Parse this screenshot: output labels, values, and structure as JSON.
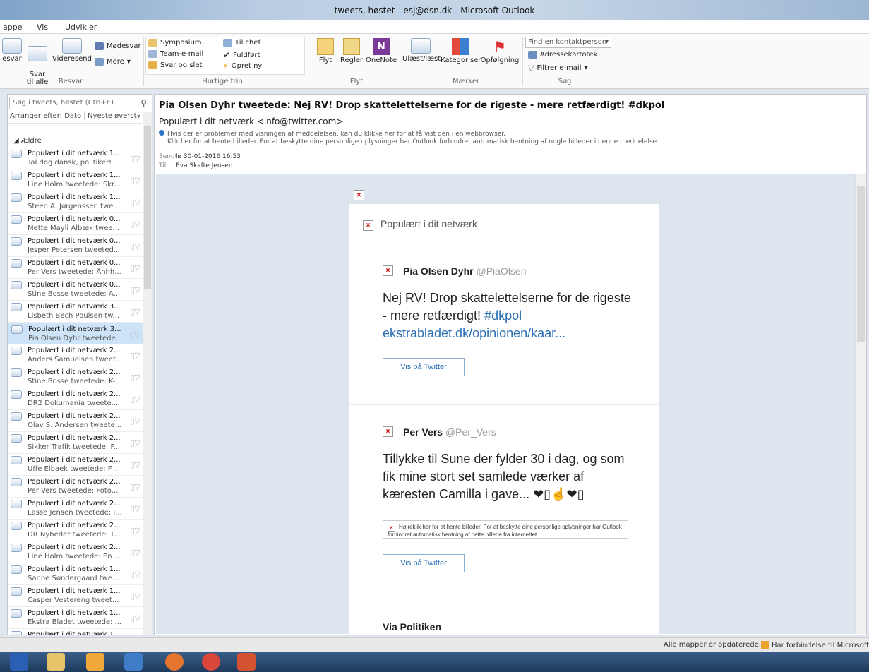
{
  "window": {
    "title": "tweets, høstet - esj@dsn.dk - Microsoft Outlook"
  },
  "menu": {
    "tabs": [
      "appe",
      "Vis",
      "Udvikler"
    ]
  },
  "ribbon": {
    "besvar": {
      "reply": "esvar",
      "reply_all": "Svar\ntil alle",
      "forward": "Videresend",
      "meeting": "Mødesvar",
      "more": "Mere",
      "group": "Besvar"
    },
    "quicksteps": {
      "items": [
        "Symposium",
        "Team-e-mail",
        "Svar og slet",
        "Til chef",
        "Fuldført",
        "Opret ny"
      ],
      "group": "Hurtige trin"
    },
    "move": {
      "move": "Flyt",
      "rules": "Regler",
      "onenote": "OneNote",
      "group": "Flyt"
    },
    "tags": {
      "read": "Ulæst/læst",
      "categorize": "Kategoriser",
      "followup": "Opfølgning",
      "group": "Mærker"
    },
    "find": {
      "contact_placeholder": "Find en kontaktperson",
      "addressbook": "Adressekartotek",
      "filter": "Filtrer e-mail",
      "group": "Søg"
    }
  },
  "leftpane": {
    "search_placeholder": "Søg i tweets, høstet (Ctrl+E)",
    "sort_by": "Arranger efter: Dato",
    "sort_order": "Nyeste øverst",
    "group": "Ældre",
    "messages": [
      {
        "subject": "Populært i dit netværk 1...",
        "preview": "Tal dog dansk, politiker!"
      },
      {
        "subject": "Populært i dit netværk 1...",
        "preview": "Line Holm tweetede: Skr..."
      },
      {
        "subject": "Populært i dit netværk 1...",
        "preview": "Steen A. Jørgenssen twe..."
      },
      {
        "subject": "Populært i dit netværk 0...",
        "preview": "Mette Mayli Albæk twee..."
      },
      {
        "subject": "Populært i dit netværk 0...",
        "preview": "Jesper Petersen tweeted..."
      },
      {
        "subject": "Populært i dit netværk 0...",
        "preview": "Per Vers tweetede: Åhhh..."
      },
      {
        "subject": "Populært i dit netværk 0...",
        "preview": "Stine Bosse tweetede: A..."
      },
      {
        "subject": "Populært i dit netværk 3...",
        "preview": "Lisbeth Bech Poulsen tw..."
      },
      {
        "subject": "Populært i dit netværk 3...",
        "preview": "Pia Olsen Dyhr tweetede..."
      },
      {
        "subject": "Populært i dit netværk 2...",
        "preview": "Anders Samuelsen tweet..."
      },
      {
        "subject": "Populært i dit netværk 2...",
        "preview": "Stine Bosse tweetede: K-..."
      },
      {
        "subject": "Populært i dit netværk 2...",
        "preview": "DR2 Dokumania tweete..."
      },
      {
        "subject": "Populært i dit netværk 2...",
        "preview": "Olav S. Andersen tweete..."
      },
      {
        "subject": "Populært i dit netværk 2...",
        "preview": "Sikker Trafik tweetede: F..."
      },
      {
        "subject": "Populært i dit netværk 2...",
        "preview": "Uffe Elbaek tweetede: F..."
      },
      {
        "subject": "Populært i dit netværk 2...",
        "preview": "Per Vers tweetede: Foto..."
      },
      {
        "subject": "Populært i dit netværk 2...",
        "preview": "Lasse Jensen tweetede: I..."
      },
      {
        "subject": "Populært i dit netværk 2...",
        "preview": "DR Nyheder tweetede: T..."
      },
      {
        "subject": "Populært i dit netværk 2...",
        "preview": "Line Holm tweetede: En ..."
      },
      {
        "subject": "Populært i dit netværk 1...",
        "preview": "Sanne Søndergaard twe..."
      },
      {
        "subject": "Populært i dit netværk 1...",
        "preview": "Casper Vestereng tweet..."
      },
      {
        "subject": "Populært i dit netværk 1...",
        "preview": "Ekstra Bladet tweetede: ..."
      },
      {
        "subject": "Populært i dit netværk 1",
        "preview": ""
      }
    ],
    "selected_index": 8
  },
  "reading": {
    "subject": "Pia Olsen Dyhr tweetede: Nej RV! Drop skattelettelserne for de rigeste - mere retfærdigt! #dkpol",
    "from": "Populært i dit netværk <info@twitter.com>",
    "info1": "Hvis der er problemer med visningen af meddelelsen, kan du klikke her for at få vist den i en webbrowser.",
    "info2": "Klik her for at hente billeder. For at beskytte dine personlige oplysninger har Outlook forhindret automatisk hentning af nogle billeder i denne meddelelse.",
    "sent_label": "Sendt:",
    "sent": "lø 30-01-2016 16:53",
    "to_label": "Til:",
    "to": "Eva Skafte Jensen",
    "card_header": "Populært i dit netværk",
    "tweet1": {
      "name": "Pia Olsen Dyhr",
      "handle": "@PiaOlsen",
      "text": "Nej RV! Drop skattelettelserne for de rigeste - mere retfærdigt!",
      "hashtag": "#dkpol",
      "link": "ekstrabladet.dk/opinionen/kaar...",
      "button": "Vis på Twitter"
    },
    "tweet2": {
      "name": "Per Vers",
      "handle": "@Per_Vers",
      "text": "Tillykke til Sune der fylder 30 i dag, og som fik mine stort set samlede værker af kæresten Camilla i gave... ❤▯☝❤▯",
      "notice": "Højreklik her for at hente billeder. For at beskytte dine personlige oplysninger har Outlook forhindret automatisk hentning af dette billede fra internettet.",
      "button": "Vis på Twitter"
    },
    "via": "Via Politiken"
  },
  "status": {
    "left": "Alle mapper er opdaterede.",
    "right": "Har forbindelse til Microsoft E"
  }
}
